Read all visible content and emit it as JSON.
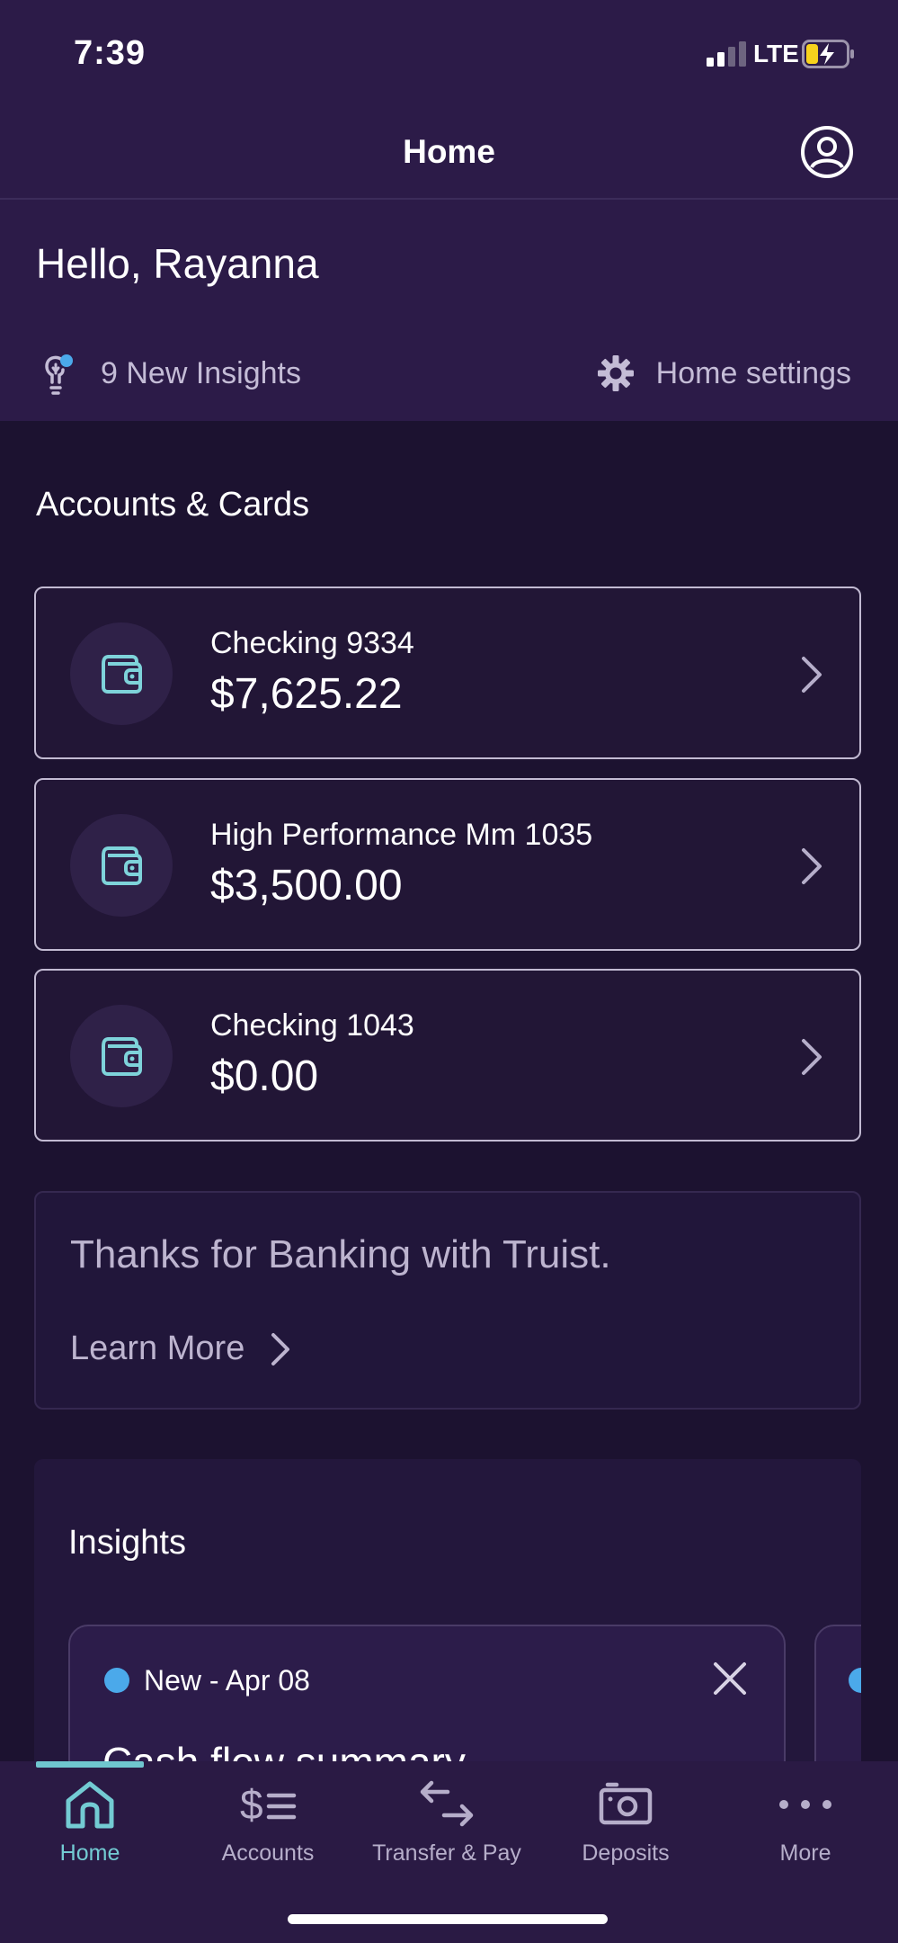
{
  "status_bar": {
    "time": "7:39",
    "network": "LTE"
  },
  "header": {
    "title": "Home"
  },
  "greeting": "Hello, Rayanna",
  "quick_links": {
    "insights": "9 New Insights",
    "settings": "Home settings"
  },
  "accounts_section": {
    "title": "Accounts & Cards",
    "accounts": [
      {
        "name": "Checking 9334",
        "balance": "$7,625.22"
      },
      {
        "name": "High Performance Mm 1035",
        "balance": "$3,500.00"
      },
      {
        "name": "Checking 1043",
        "balance": "$0.00"
      }
    ]
  },
  "promo": {
    "text": "Thanks for Banking with Truist.",
    "link": "Learn More"
  },
  "insights": {
    "title": "Insights",
    "cards": [
      {
        "badge": "New - Apr 08",
        "heading": "Cash flow summary"
      }
    ]
  },
  "tab_bar": {
    "active": "Home",
    "tabs": [
      {
        "label": "Home",
        "icon": "home-icon"
      },
      {
        "label": "Accounts",
        "icon": "accounts-icon"
      },
      {
        "label": "Transfer & Pay",
        "icon": "transfer-icon"
      },
      {
        "label": "Deposits",
        "icon": "deposit-icon"
      },
      {
        "label": "More",
        "icon": "more-icon"
      }
    ]
  },
  "colors": {
    "background": "#1c1230",
    "header": "#2c1b48",
    "accent": "#73cbd3",
    "insight_dot": "#4ba9ea",
    "battery_charging": "#f7d21d"
  }
}
